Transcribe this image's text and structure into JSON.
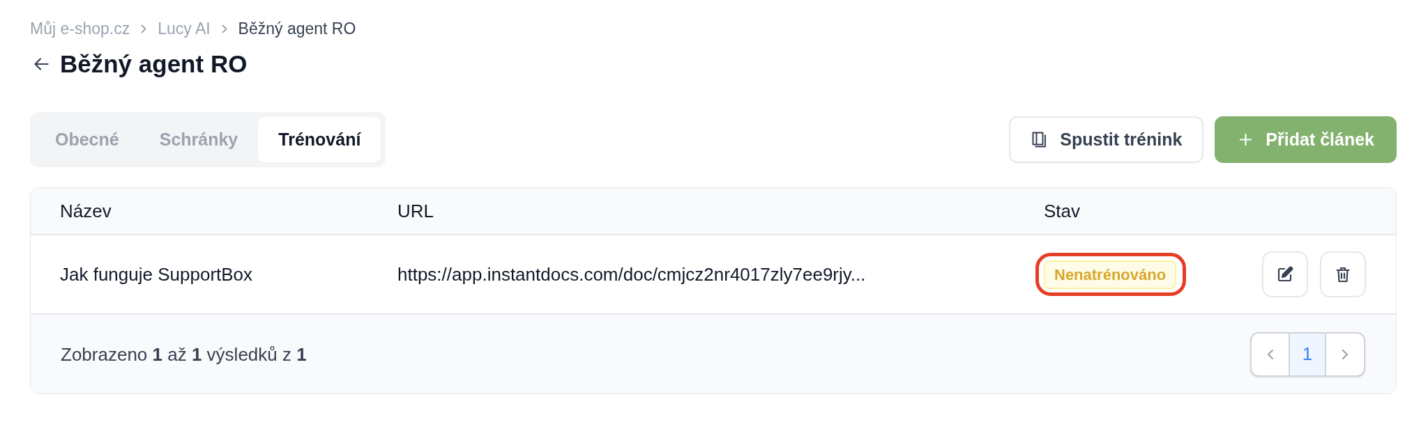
{
  "breadcrumb": [
    {
      "label": "Můj e-shop.cz",
      "current": false
    },
    {
      "label": "Lucy AI",
      "current": false
    },
    {
      "label": "Běžný agent RO",
      "current": true
    }
  ],
  "page": {
    "title": "Běžný agent RO"
  },
  "tabs": [
    {
      "label": "Obecné",
      "selected": false
    },
    {
      "label": "Schránky",
      "selected": false
    },
    {
      "label": "Trénování",
      "selected": true
    }
  ],
  "actions": [
    {
      "kind": "secondary",
      "label": "Spustit trénink"
    },
    {
      "kind": "primary",
      "label": "Přidat článek"
    }
  ],
  "table": {
    "columns": [
      "Název",
      "URL",
      "Stav"
    ],
    "rows": [
      {
        "name": "Jak funguje SupportBox",
        "url": "https://app.instantdocs.com/doc/cmjcz2nr4017zly7ee9rjy...",
        "status": "Nenatrénováno",
        "highlighted": true
      }
    ]
  },
  "footer": {
    "summary": "Zobrazeno **1** až **1** výsledků z **1**",
    "pages": [
      {
        "label": "1",
        "selected": true
      }
    ]
  }
}
